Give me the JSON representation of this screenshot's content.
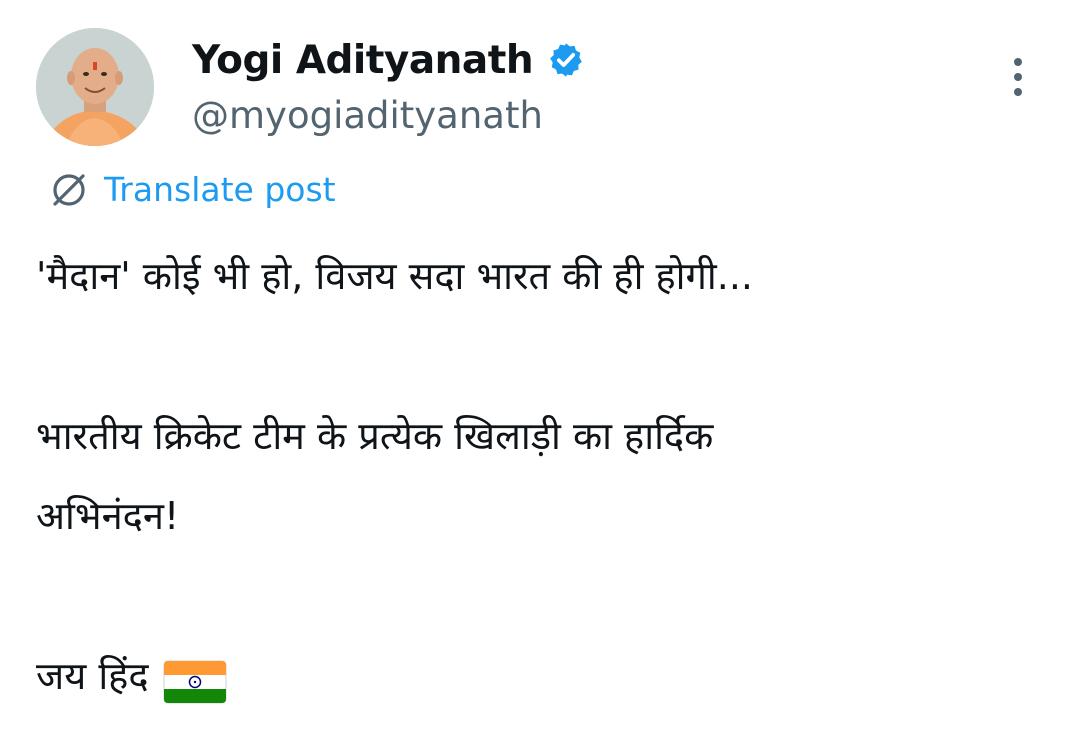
{
  "post": {
    "author": {
      "display_name": "Yogi Adityanath",
      "handle": "@myogiadityanath",
      "verified": true,
      "avatar_icon": "profile-photo"
    },
    "more_icon": "vertical-ellipsis-icon",
    "translate_label": "Translate post",
    "text_lines": [
      "'मैदान' कोई भी हो, विजय सदा भारत की ही होगी...",
      "",
      "भारतीय क्रिकेट टीम के प्रत्येक खिलाड़ी का हार्दिक",
      "अभिनंदन!",
      "",
      "जय हिंद"
    ],
    "emoji": "india-flag-icon"
  },
  "colors": {
    "text": "#0f1419",
    "secondary": "#536471",
    "link": "#1d9bf0",
    "verified": "#1d9bf0",
    "background": "#ffffff"
  }
}
